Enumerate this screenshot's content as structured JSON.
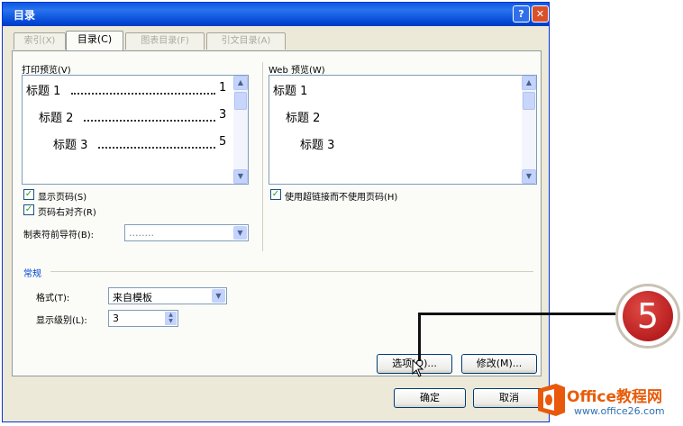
{
  "dialog": {
    "title": "目录",
    "help_glyph": "?",
    "close_glyph": "✕"
  },
  "tabs": [
    "索引(X)",
    "目录(C)",
    "图表目录(F)",
    "引文目录(A)"
  ],
  "print_preview": {
    "label": "打印预览(V)",
    "entries": [
      {
        "text": "标题 1",
        "page": "1"
      },
      {
        "text": "标题 2",
        "page": "3"
      },
      {
        "text": "标题 3",
        "page": "5"
      }
    ]
  },
  "web_preview": {
    "label": "Web 预览(W)",
    "entries": [
      "标题 1",
      "标题 2",
      "标题 3"
    ]
  },
  "options": {
    "show_page_numbers": {
      "label": "显示页码(S)",
      "checked": true
    },
    "right_align": {
      "label": "页码右对齐(R)",
      "checked": true
    },
    "tab_leader_label": "制表符前导符(B):",
    "tab_leader_value": "........",
    "use_hyperlinks": {
      "label": "使用超链接而不使用页码(H)",
      "checked": true
    }
  },
  "general": {
    "section_label": "常规",
    "formats_label": "格式(T):",
    "formats_value": "来自模板",
    "levels_label": "显示级别(L):",
    "levels_value": "3"
  },
  "buttons": {
    "options": "选项(O)...",
    "modify": "修改(M)...",
    "ok": "确定",
    "cancel": "取消"
  },
  "callout": {
    "number": "5",
    "color": "#c0201f"
  },
  "watermark": {
    "title": "Office教程网",
    "url": "www.office26.com"
  },
  "colors": {
    "titlebar": "#0a5ae0",
    "dialog_bg": "#ece9d8",
    "checkmark": "#21a121"
  }
}
